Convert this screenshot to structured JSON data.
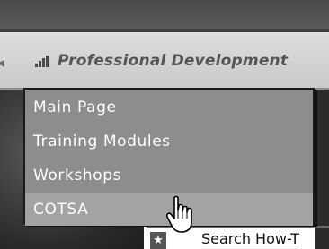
{
  "nav": {
    "icon": "bars-icon",
    "label": "Professional Development"
  },
  "dropdown": {
    "items": [
      {
        "label": "Main Page"
      },
      {
        "label": "Training Modules"
      },
      {
        "label": "Workshops"
      },
      {
        "label": "COTSA",
        "hovered": true
      }
    ]
  },
  "background": {
    "search_link": "Search How-T",
    "star_icon": "star-icon"
  },
  "cursor": "hand-pointer-icon",
  "colors": {
    "nav_text": "#555555",
    "menu_bg": "#8d8d8d",
    "menu_hover_bg": "#a3a3a3",
    "menu_text": "#ffffff"
  }
}
